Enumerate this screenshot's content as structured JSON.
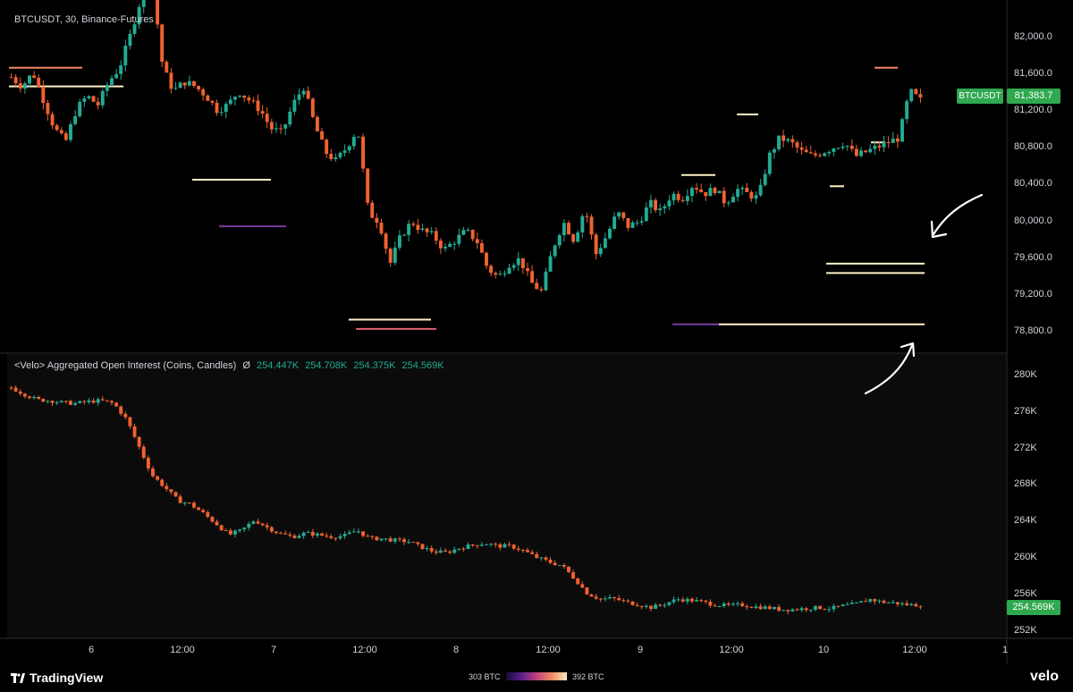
{
  "header": {
    "title": "BTCUSDT, 30, Binance-Futures"
  },
  "oi_legend": {
    "title": "<Velo> Aggregated Open Interest (Coins, Candles)",
    "symbol": "Ø",
    "open": "254.447K",
    "high": "254.708K",
    "low": "254.375K",
    "close": "254.569K"
  },
  "price_axis": {
    "labels": [
      "82,000.0",
      "81,600.0",
      "81,200.0",
      "80,800.0",
      "80,400.0",
      "80,000.0",
      "79,600.0",
      "79,200.0",
      "78,800.0"
    ]
  },
  "oi_axis": {
    "labels": [
      "280K",
      "276K",
      "272K",
      "268K",
      "264K",
      "260K",
      "256K",
      "252K"
    ]
  },
  "time_axis": {
    "labels": [
      "6",
      "12:00",
      "7",
      "12:00",
      "8",
      "12:00",
      "9",
      "12:00",
      "10",
      "12:00",
      "1"
    ]
  },
  "tags": {
    "symbol": "BTCUSDT",
    "last_price": "81,383.7",
    "last_oi": "254.569K"
  },
  "footer": {
    "brand": "TradingView",
    "heatmap_min": "303 BTC",
    "heatmap_max": "392 BTC",
    "velo": "velo"
  },
  "colors": {
    "up": "#22ab94",
    "down": "#f0622f",
    "liquidity": "#fff2c8",
    "tag": "#2fa84f"
  },
  "chart_data": [
    {
      "type": "candlestick",
      "title": "BTCUSDT, 30, Binance-Futures",
      "ylim": [
        78600,
        82300
      ],
      "x_ticks": [
        "6",
        "12:00",
        "7",
        "12:00",
        "8",
        "12:00",
        "9",
        "12:00",
        "10",
        "12:00",
        "1"
      ],
      "close_path": [
        81550,
        81450,
        81600,
        81300,
        81000,
        80850,
        81200,
        81350,
        81250,
        81500,
        81650,
        82000,
        82400,
        82600,
        81650,
        81400,
        81500,
        81450,
        81350,
        81200,
        81250,
        81400,
        81300,
        81200,
        81000,
        80950,
        81250,
        81450,
        81050,
        80750,
        80650,
        80800,
        81000,
        80100,
        80000,
        79550,
        79850,
        80000,
        79900,
        79850,
        79700,
        79800,
        79900,
        79800,
        79500,
        79400,
        79550,
        79600,
        79350,
        79250,
        79700,
        80000,
        79800,
        80150,
        79650,
        79850,
        80100,
        79950,
        80000,
        80200,
        80100,
        80300,
        80250,
        80400,
        80300,
        80350,
        80200,
        80350,
        80300,
        80250,
        80700,
        80900,
        80850,
        80750,
        80700,
        80750,
        80800,
        80850,
        80700,
        80750,
        80800,
        80850,
        80900,
        81400,
        81300
      ],
      "last": 81383.7,
      "liquidity_levels": [
        79550,
        79450,
        78900,
        78850,
        81150,
        80500,
        79950,
        78950
      ]
    },
    {
      "type": "candlestick",
      "title": "<Velo> Aggregated Open Interest (Coins, Candles)",
      "ylim": [
        251000,
        281500
      ],
      "x_ticks": [
        "6",
        "12:00",
        "7",
        "12:00",
        "8",
        "12:00",
        "9",
        "12:00",
        "10",
        "12:00",
        "1"
      ],
      "close_path": [
        277900,
        277200,
        276600,
        276500,
        276300,
        276200,
        276400,
        276500,
        276200,
        274500,
        271500,
        268500,
        267200,
        265800,
        265400,
        264400,
        263300,
        262100,
        262600,
        263700,
        262900,
        262200,
        261900,
        262300,
        262100,
        261900,
        262000,
        262600,
        261700,
        261700,
        261500,
        261400,
        260800,
        260300,
        260200,
        260700,
        261000,
        261200,
        260900,
        260900,
        260400,
        259700,
        259200,
        258800,
        257400,
        255800,
        255200,
        255300,
        254900,
        254600,
        254300,
        254700,
        255200,
        255100,
        254900,
        254600,
        254500,
        254600,
        254400,
        254300,
        254100,
        254100,
        254200,
        254300,
        254200,
        254500,
        254700,
        255200,
        254900,
        254800,
        254600,
        254569
      ],
      "last": 254569
    }
  ]
}
